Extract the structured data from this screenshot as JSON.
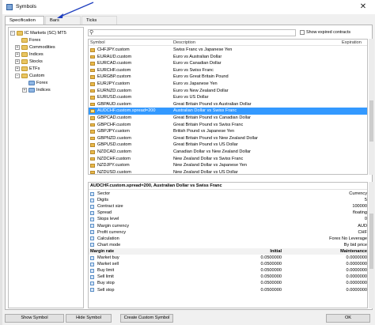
{
  "window": {
    "title": "Symbols",
    "close_glyph": "✕"
  },
  "tabs": [
    {
      "label": "Specification",
      "active": true
    },
    {
      "label": "Bars",
      "active": false
    },
    {
      "label": "Ticks",
      "active": false
    }
  ],
  "tree": {
    "root": "IC Markets (SC) MT5",
    "items": [
      {
        "label": "Forex",
        "toggle": "",
        "icon": "folder"
      },
      {
        "label": "Commodities",
        "toggle": "+",
        "icon": "folder"
      },
      {
        "label": "Indices",
        "toggle": "+",
        "icon": "folder"
      },
      {
        "label": "Stocks",
        "toggle": "+",
        "icon": "folder"
      },
      {
        "label": "ETFs",
        "toggle": "+",
        "icon": "folder"
      },
      {
        "label": "Custom",
        "toggle": "−",
        "icon": "folder"
      }
    ],
    "custom_children": [
      {
        "label": "Forex",
        "toggle": "",
        "icon": "folder-blue"
      },
      {
        "label": "Indices",
        "toggle": "+",
        "icon": "folder-blue"
      }
    ]
  },
  "search": {
    "placeholder": "",
    "icon": "search-icon"
  },
  "show_expired": {
    "label": "Show expired contracts",
    "checked": false
  },
  "symbols": {
    "columns": [
      "Symbol",
      "Description",
      "Expiration"
    ],
    "rows": [
      {
        "symbol": "CHFJPY.custom",
        "description": "Swiss Franc vs Japanese Yen"
      },
      {
        "symbol": "EURAUD.custom",
        "description": "Euro vs Australian Dollar"
      },
      {
        "symbol": "EURCAD.custom",
        "description": "Euro vs Canadian Dollar"
      },
      {
        "symbol": "EURCHF.custom",
        "description": "Euro vs Swiss Franc"
      },
      {
        "symbol": "EURGBP.custom",
        "description": "Euro vs Great Britain Pound"
      },
      {
        "symbol": "EURJPY.custom",
        "description": "Euro vs Japanese Yen"
      },
      {
        "symbol": "EURNZD.custom",
        "description": "Euro vs New Zealand Dollar"
      },
      {
        "symbol": "EURUSD.custom",
        "description": "Euro vs US Dollar"
      },
      {
        "symbol": "GBPAUD.custom",
        "description": "Great Britain Pound vs Australian Dollar"
      },
      {
        "symbol": "AUDCHF.custom.spread=200",
        "description": "Australian Dollar vs Swiss Franc",
        "selected": true
      },
      {
        "symbol": "GBPCAD.custom",
        "description": "Great Britain Pound vs Canadian Dollar"
      },
      {
        "symbol": "GBPCHF.custom",
        "description": "Great Britain Pound vs Swiss Franc"
      },
      {
        "symbol": "GBPJPY.custom",
        "description": "British Pound vs Japanese Yen"
      },
      {
        "symbol": "GBPNZD.custom",
        "description": "Great Britain Pound vs New Zealand Dollar"
      },
      {
        "symbol": "GBPUSD.custom",
        "description": "Great Britain Pound vs US Dollar"
      },
      {
        "symbol": "NZDCAD.custom",
        "description": "Canadian Dollar vs New Zealand Dollar"
      },
      {
        "symbol": "NZDCHF.custom",
        "description": "New Zealand Dollar vs Swiss Franc"
      },
      {
        "symbol": "NZDJPY.custom",
        "description": "New Zealand Dollar vs Japanese Yen"
      },
      {
        "symbol": "NZDUSD.custom",
        "description": "New Zealand Dollar vs US Dollar"
      }
    ]
  },
  "properties": {
    "title": "AUDCHF.custom.spread=200, Australian Dollar vs Swiss Franc",
    "rows": [
      {
        "name": "Sector",
        "value": "Currency"
      },
      {
        "name": "Digits",
        "value": "5"
      },
      {
        "name": "Contract size",
        "value": "100000"
      },
      {
        "name": "Spread",
        "value": "floating"
      },
      {
        "name": "Stops level",
        "value": "0"
      },
      {
        "name": "Margin currency",
        "value": "AUD"
      },
      {
        "name": "Profit currency",
        "value": "CHF"
      },
      {
        "name": "Calculation",
        "value": "Forex No Leverage"
      },
      {
        "name": "Chart mode",
        "value": "By bid price"
      }
    ],
    "margin_header": {
      "name": "Margin rate",
      "initial": "Initial",
      "maintenance": "Maintenance"
    },
    "margin_rows": [
      {
        "name": "Market buy",
        "initial": "0.0500000",
        "maintenance": "0.0000000"
      },
      {
        "name": "Market sell",
        "initial": "0.0500000",
        "maintenance": "0.0000000"
      },
      {
        "name": "Buy limit",
        "initial": "0.0500000",
        "maintenance": "0.0000000"
      },
      {
        "name": "Sell limit",
        "initial": "0.0500000",
        "maintenance": "0.0000000"
      },
      {
        "name": "Buy stop",
        "initial": "0.0500000",
        "maintenance": "0.0000000"
      },
      {
        "name": "Sell stop",
        "initial": "0.0500000",
        "maintenance": "0.0000000"
      }
    ]
  },
  "buttons": {
    "show_symbol": "Show Symbol",
    "hide_symbol": "Hide Symbol",
    "create_custom": "Create Custom Symbol",
    "ok": "OK"
  },
  "colors": {
    "selection": "#3399ff",
    "annotation_arrow": "#1f3fbf"
  }
}
